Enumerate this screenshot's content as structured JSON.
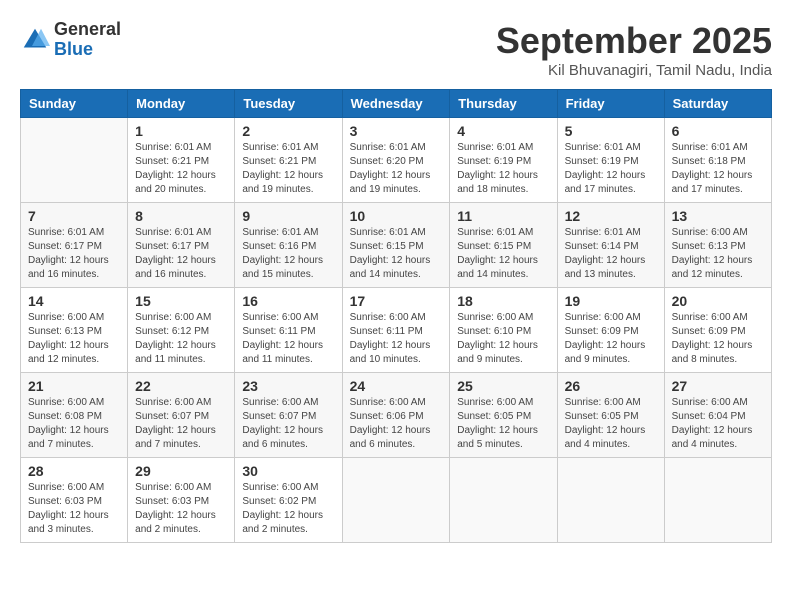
{
  "header": {
    "logo_line1": "General",
    "logo_line2": "Blue",
    "month": "September 2025",
    "location": "Kil Bhuvanagiri, Tamil Nadu, India"
  },
  "days_of_week": [
    "Sunday",
    "Monday",
    "Tuesday",
    "Wednesday",
    "Thursday",
    "Friday",
    "Saturday"
  ],
  "weeks": [
    [
      {
        "day": "",
        "info": ""
      },
      {
        "day": "1",
        "info": "Sunrise: 6:01 AM\nSunset: 6:21 PM\nDaylight: 12 hours\nand 20 minutes."
      },
      {
        "day": "2",
        "info": "Sunrise: 6:01 AM\nSunset: 6:21 PM\nDaylight: 12 hours\nand 19 minutes."
      },
      {
        "day": "3",
        "info": "Sunrise: 6:01 AM\nSunset: 6:20 PM\nDaylight: 12 hours\nand 19 minutes."
      },
      {
        "day": "4",
        "info": "Sunrise: 6:01 AM\nSunset: 6:19 PM\nDaylight: 12 hours\nand 18 minutes."
      },
      {
        "day": "5",
        "info": "Sunrise: 6:01 AM\nSunset: 6:19 PM\nDaylight: 12 hours\nand 17 minutes."
      },
      {
        "day": "6",
        "info": "Sunrise: 6:01 AM\nSunset: 6:18 PM\nDaylight: 12 hours\nand 17 minutes."
      }
    ],
    [
      {
        "day": "7",
        "info": "Sunrise: 6:01 AM\nSunset: 6:17 PM\nDaylight: 12 hours\nand 16 minutes."
      },
      {
        "day": "8",
        "info": "Sunrise: 6:01 AM\nSunset: 6:17 PM\nDaylight: 12 hours\nand 16 minutes."
      },
      {
        "day": "9",
        "info": "Sunrise: 6:01 AM\nSunset: 6:16 PM\nDaylight: 12 hours\nand 15 minutes."
      },
      {
        "day": "10",
        "info": "Sunrise: 6:01 AM\nSunset: 6:15 PM\nDaylight: 12 hours\nand 14 minutes."
      },
      {
        "day": "11",
        "info": "Sunrise: 6:01 AM\nSunset: 6:15 PM\nDaylight: 12 hours\nand 14 minutes."
      },
      {
        "day": "12",
        "info": "Sunrise: 6:01 AM\nSunset: 6:14 PM\nDaylight: 12 hours\nand 13 minutes."
      },
      {
        "day": "13",
        "info": "Sunrise: 6:00 AM\nSunset: 6:13 PM\nDaylight: 12 hours\nand 12 minutes."
      }
    ],
    [
      {
        "day": "14",
        "info": "Sunrise: 6:00 AM\nSunset: 6:13 PM\nDaylight: 12 hours\nand 12 minutes."
      },
      {
        "day": "15",
        "info": "Sunrise: 6:00 AM\nSunset: 6:12 PM\nDaylight: 12 hours\nand 11 minutes."
      },
      {
        "day": "16",
        "info": "Sunrise: 6:00 AM\nSunset: 6:11 PM\nDaylight: 12 hours\nand 11 minutes."
      },
      {
        "day": "17",
        "info": "Sunrise: 6:00 AM\nSunset: 6:11 PM\nDaylight: 12 hours\nand 10 minutes."
      },
      {
        "day": "18",
        "info": "Sunrise: 6:00 AM\nSunset: 6:10 PM\nDaylight: 12 hours\nand 9 minutes."
      },
      {
        "day": "19",
        "info": "Sunrise: 6:00 AM\nSunset: 6:09 PM\nDaylight: 12 hours\nand 9 minutes."
      },
      {
        "day": "20",
        "info": "Sunrise: 6:00 AM\nSunset: 6:09 PM\nDaylight: 12 hours\nand 8 minutes."
      }
    ],
    [
      {
        "day": "21",
        "info": "Sunrise: 6:00 AM\nSunset: 6:08 PM\nDaylight: 12 hours\nand 7 minutes."
      },
      {
        "day": "22",
        "info": "Sunrise: 6:00 AM\nSunset: 6:07 PM\nDaylight: 12 hours\nand 7 minutes."
      },
      {
        "day": "23",
        "info": "Sunrise: 6:00 AM\nSunset: 6:07 PM\nDaylight: 12 hours\nand 6 minutes."
      },
      {
        "day": "24",
        "info": "Sunrise: 6:00 AM\nSunset: 6:06 PM\nDaylight: 12 hours\nand 6 minutes."
      },
      {
        "day": "25",
        "info": "Sunrise: 6:00 AM\nSunset: 6:05 PM\nDaylight: 12 hours\nand 5 minutes."
      },
      {
        "day": "26",
        "info": "Sunrise: 6:00 AM\nSunset: 6:05 PM\nDaylight: 12 hours\nand 4 minutes."
      },
      {
        "day": "27",
        "info": "Sunrise: 6:00 AM\nSunset: 6:04 PM\nDaylight: 12 hours\nand 4 minutes."
      }
    ],
    [
      {
        "day": "28",
        "info": "Sunrise: 6:00 AM\nSunset: 6:03 PM\nDaylight: 12 hours\nand 3 minutes."
      },
      {
        "day": "29",
        "info": "Sunrise: 6:00 AM\nSunset: 6:03 PM\nDaylight: 12 hours\nand 2 minutes."
      },
      {
        "day": "30",
        "info": "Sunrise: 6:00 AM\nSunset: 6:02 PM\nDaylight: 12 hours\nand 2 minutes."
      },
      {
        "day": "",
        "info": ""
      },
      {
        "day": "",
        "info": ""
      },
      {
        "day": "",
        "info": ""
      },
      {
        "day": "",
        "info": ""
      }
    ]
  ]
}
